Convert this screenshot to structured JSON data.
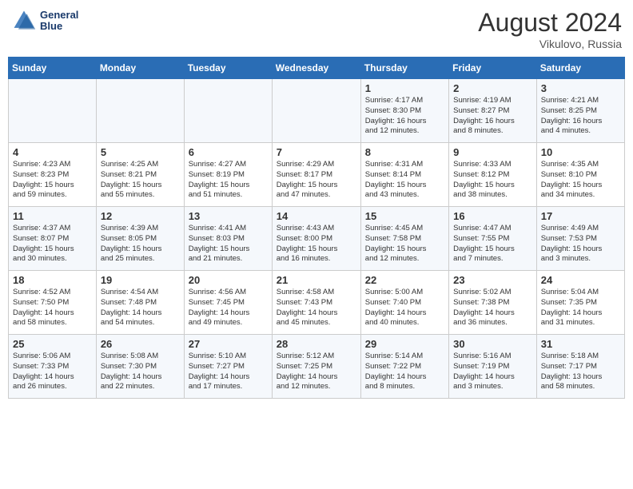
{
  "header": {
    "logo_line1": "General",
    "logo_line2": "Blue",
    "month_year": "August 2024",
    "location": "Vikulovo, Russia"
  },
  "days_of_week": [
    "Sunday",
    "Monday",
    "Tuesday",
    "Wednesday",
    "Thursday",
    "Friday",
    "Saturday"
  ],
  "weeks": [
    [
      {
        "day": "",
        "info": ""
      },
      {
        "day": "",
        "info": ""
      },
      {
        "day": "",
        "info": ""
      },
      {
        "day": "",
        "info": ""
      },
      {
        "day": "1",
        "info": "Sunrise: 4:17 AM\nSunset: 8:30 PM\nDaylight: 16 hours\nand 12 minutes."
      },
      {
        "day": "2",
        "info": "Sunrise: 4:19 AM\nSunset: 8:27 PM\nDaylight: 16 hours\nand 8 minutes."
      },
      {
        "day": "3",
        "info": "Sunrise: 4:21 AM\nSunset: 8:25 PM\nDaylight: 16 hours\nand 4 minutes."
      }
    ],
    [
      {
        "day": "4",
        "info": "Sunrise: 4:23 AM\nSunset: 8:23 PM\nDaylight: 15 hours\nand 59 minutes."
      },
      {
        "day": "5",
        "info": "Sunrise: 4:25 AM\nSunset: 8:21 PM\nDaylight: 15 hours\nand 55 minutes."
      },
      {
        "day": "6",
        "info": "Sunrise: 4:27 AM\nSunset: 8:19 PM\nDaylight: 15 hours\nand 51 minutes."
      },
      {
        "day": "7",
        "info": "Sunrise: 4:29 AM\nSunset: 8:17 PM\nDaylight: 15 hours\nand 47 minutes."
      },
      {
        "day": "8",
        "info": "Sunrise: 4:31 AM\nSunset: 8:14 PM\nDaylight: 15 hours\nand 43 minutes."
      },
      {
        "day": "9",
        "info": "Sunrise: 4:33 AM\nSunset: 8:12 PM\nDaylight: 15 hours\nand 38 minutes."
      },
      {
        "day": "10",
        "info": "Sunrise: 4:35 AM\nSunset: 8:10 PM\nDaylight: 15 hours\nand 34 minutes."
      }
    ],
    [
      {
        "day": "11",
        "info": "Sunrise: 4:37 AM\nSunset: 8:07 PM\nDaylight: 15 hours\nand 30 minutes."
      },
      {
        "day": "12",
        "info": "Sunrise: 4:39 AM\nSunset: 8:05 PM\nDaylight: 15 hours\nand 25 minutes."
      },
      {
        "day": "13",
        "info": "Sunrise: 4:41 AM\nSunset: 8:03 PM\nDaylight: 15 hours\nand 21 minutes."
      },
      {
        "day": "14",
        "info": "Sunrise: 4:43 AM\nSunset: 8:00 PM\nDaylight: 15 hours\nand 16 minutes."
      },
      {
        "day": "15",
        "info": "Sunrise: 4:45 AM\nSunset: 7:58 PM\nDaylight: 15 hours\nand 12 minutes."
      },
      {
        "day": "16",
        "info": "Sunrise: 4:47 AM\nSunset: 7:55 PM\nDaylight: 15 hours\nand 7 minutes."
      },
      {
        "day": "17",
        "info": "Sunrise: 4:49 AM\nSunset: 7:53 PM\nDaylight: 15 hours\nand 3 minutes."
      }
    ],
    [
      {
        "day": "18",
        "info": "Sunrise: 4:52 AM\nSunset: 7:50 PM\nDaylight: 14 hours\nand 58 minutes."
      },
      {
        "day": "19",
        "info": "Sunrise: 4:54 AM\nSunset: 7:48 PM\nDaylight: 14 hours\nand 54 minutes."
      },
      {
        "day": "20",
        "info": "Sunrise: 4:56 AM\nSunset: 7:45 PM\nDaylight: 14 hours\nand 49 minutes."
      },
      {
        "day": "21",
        "info": "Sunrise: 4:58 AM\nSunset: 7:43 PM\nDaylight: 14 hours\nand 45 minutes."
      },
      {
        "day": "22",
        "info": "Sunrise: 5:00 AM\nSunset: 7:40 PM\nDaylight: 14 hours\nand 40 minutes."
      },
      {
        "day": "23",
        "info": "Sunrise: 5:02 AM\nSunset: 7:38 PM\nDaylight: 14 hours\nand 36 minutes."
      },
      {
        "day": "24",
        "info": "Sunrise: 5:04 AM\nSunset: 7:35 PM\nDaylight: 14 hours\nand 31 minutes."
      }
    ],
    [
      {
        "day": "25",
        "info": "Sunrise: 5:06 AM\nSunset: 7:33 PM\nDaylight: 14 hours\nand 26 minutes."
      },
      {
        "day": "26",
        "info": "Sunrise: 5:08 AM\nSunset: 7:30 PM\nDaylight: 14 hours\nand 22 minutes."
      },
      {
        "day": "27",
        "info": "Sunrise: 5:10 AM\nSunset: 7:27 PM\nDaylight: 14 hours\nand 17 minutes."
      },
      {
        "day": "28",
        "info": "Sunrise: 5:12 AM\nSunset: 7:25 PM\nDaylight: 14 hours\nand 12 minutes."
      },
      {
        "day": "29",
        "info": "Sunrise: 5:14 AM\nSunset: 7:22 PM\nDaylight: 14 hours\nand 8 minutes."
      },
      {
        "day": "30",
        "info": "Sunrise: 5:16 AM\nSunset: 7:19 PM\nDaylight: 14 hours\nand 3 minutes."
      },
      {
        "day": "31",
        "info": "Sunrise: 5:18 AM\nSunset: 7:17 PM\nDaylight: 13 hours\nand 58 minutes."
      }
    ]
  ]
}
